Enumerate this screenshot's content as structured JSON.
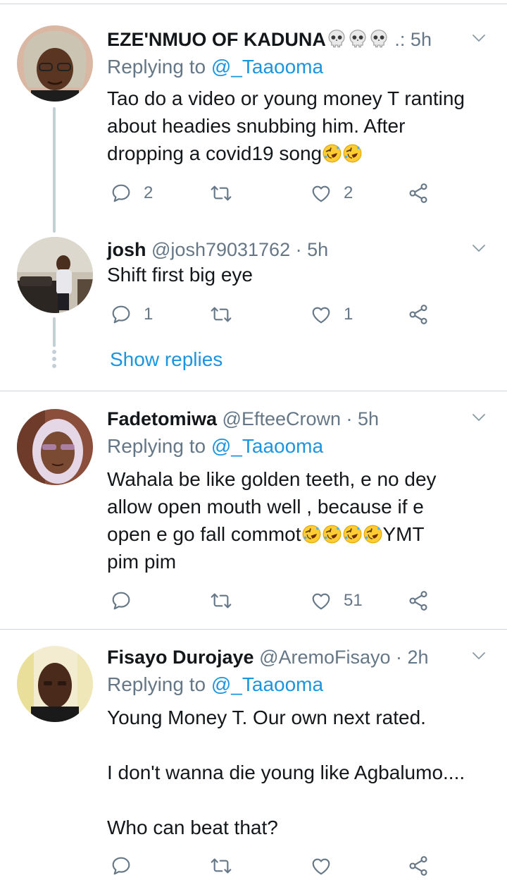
{
  "tweets": [
    {
      "name": "EZE'NMUO OF KADUNA",
      "handle_time": " .: 5h",
      "replying_label": "Replying to ",
      "replying_to": "@_Taaooma",
      "body_1": "Tao do a video or young money T ranting\nabout headies snubbing him. After\ndropping a covid19 song",
      "reply_count": "2",
      "retweet_count": "",
      "like_count": "2"
    },
    {
      "name": "josh",
      "handle_time": " @josh79031762 · 5h",
      "body_1": "Shift first big eye",
      "reply_count": "1",
      "retweet_count": "",
      "like_count": "1",
      "show_replies": "Show replies"
    },
    {
      "name": "Fadetomiwa",
      "handle_time": " @EfteeCrown · 5h",
      "replying_label": "Replying to ",
      "replying_to": "@_Taaooma",
      "body_1": "Wahala be like golden teeth, e no dey\nallow open mouth well , because if e\nopen e go fall commot",
      "body_2": "YMT\npim pim",
      "reply_count": "",
      "retweet_count": "",
      "like_count": "51"
    },
    {
      "name": "Fisayo Durojaye",
      "handle_time": " @AremoFisayo · 2h",
      "replying_label": "Replying to ",
      "replying_to": "@_Taaooma",
      "body_1": "Young Money T. Our own next rated.\n\nI don't wanna die young like Agbalumo....\n\nWho can beat that?"
    }
  ],
  "icons": {
    "reply": "reply-icon",
    "retweet": "retweet-icon",
    "like": "heart-icon",
    "share": "share-icon",
    "more": "chevron-down-icon",
    "emoji_laugh": "rolling-on-floor-laughing-emoji",
    "emoji_skull": "skull-emoji"
  },
  "colors": {
    "link": "#1b95e0",
    "secondary_text": "#657786",
    "divider": "#cfd9de",
    "thread_line": "#c4cfd6"
  }
}
